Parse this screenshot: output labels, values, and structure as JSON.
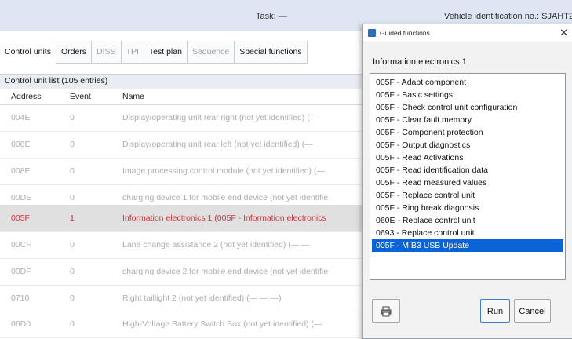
{
  "header": {
    "task": "Task: —",
    "vin": "Vehicle identification no.: SJAHT22"
  },
  "tabs": [
    {
      "label": "Control units"
    },
    {
      "label": "Orders"
    },
    {
      "label": "DISS"
    },
    {
      "label": "TPI"
    },
    {
      "label": "Test plan"
    },
    {
      "label": "Sequence"
    },
    {
      "label": "Special functions"
    }
  ],
  "list": {
    "title": "Control unit list (105 entries)",
    "columns": {
      "address": "Address",
      "event": "Event",
      "name": "Name"
    },
    "rows": [
      {
        "address": "004E",
        "event": "0",
        "name": "Display/operating unit rear right (not yet identified) (—"
      },
      {
        "address": "006E",
        "event": "0",
        "name": "Display/operating unit rear left (not yet identified) (—"
      },
      {
        "address": "008E",
        "event": "0",
        "name": "Image processing control module (not yet identified) (—"
      },
      {
        "address": "00DE",
        "event": "0",
        "name": "charging device 1 for mobile end device (not yet identifie"
      },
      {
        "address": "005F",
        "event": "1",
        "name": "Information electronics 1 (005F - Information electronics"
      },
      {
        "address": "00CF",
        "event": "0",
        "name": "Lane change assistance 2 (not yet identified) (— —"
      },
      {
        "address": "00DF",
        "event": "0",
        "name": "charging device 2 for mobile end device (not yet identifie"
      },
      {
        "address": "0710",
        "event": "0",
        "name": "Right taillight 2 (not yet identified) (— — —)"
      },
      {
        "address": "06D0",
        "event": "0",
        "name": "High-Voltage Battery Switch Box (not yet identified) (—"
      }
    ]
  },
  "dialog": {
    "title": "Guided functions",
    "subtitle": "Information electronics 1",
    "functions": [
      "005F - Adapt component",
      "005F - Basic settings",
      "005F - Check control unit configuration",
      "005F - Clear fault memory",
      "005F - Component protection",
      "005F - Output diagnostics",
      "005F - Read Activations",
      "005F - Read identification data",
      "005F - Read measured values",
      "005F - Replace control unit",
      "005F - Ring break diagnosis",
      "060E - Replace control unit",
      "0693 - Replace control unit",
      "005F - MIB3 USB Update"
    ],
    "run_label": "Run",
    "cancel_label": "Cancel"
  }
}
